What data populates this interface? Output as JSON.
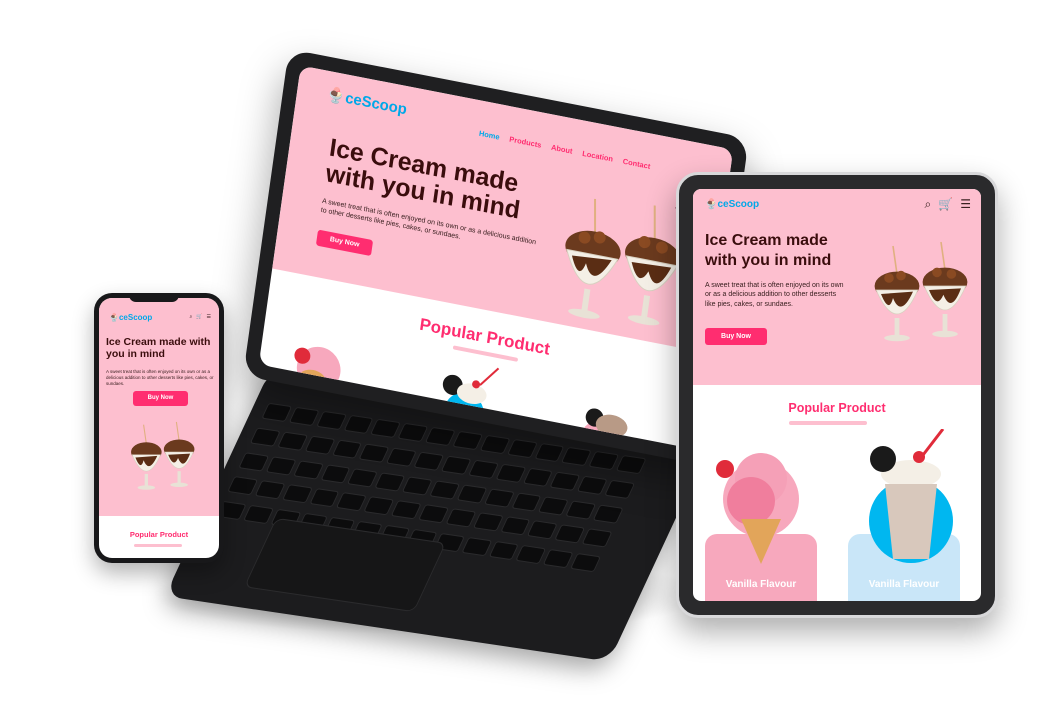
{
  "colors": {
    "primary_pink": "#ff2d70",
    "hero_pink": "#fdbfcf",
    "brand_blue": "#00a8e8",
    "title_brown": "#3a0d0d",
    "device_black": "#1c1c1e"
  },
  "brand": {
    "logo_prefix_icon": "ice-cream-cup-icon",
    "logo_text": "ceScoop"
  },
  "nav": {
    "items": [
      "Home",
      "Products",
      "About",
      "Location",
      "Contact"
    ],
    "active": "Home"
  },
  "icons": {
    "search": "search-icon",
    "cart": "cart-icon",
    "menu": "hamburger-menu-icon"
  },
  "hero": {
    "title": "Ice Cream made with you in mind",
    "description": "A sweet treat that is often enjoyed on its own or as a delicious addition to other desserts like pies, cakes, or sundaes.",
    "button": "Buy Now"
  },
  "popular": {
    "title": "Popular Product",
    "products": [
      {
        "name": "Vanilla Flavour",
        "card_color": "#f7a8bd"
      },
      {
        "name": "Vanilla Flavour",
        "card_color": "#c9e6f8"
      }
    ]
  }
}
